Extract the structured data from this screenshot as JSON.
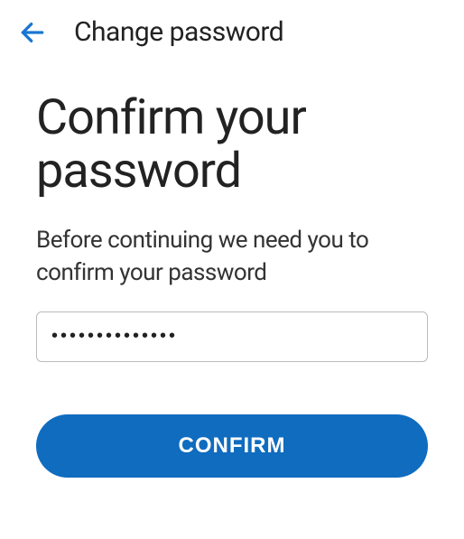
{
  "header": {
    "title": "Change password"
  },
  "main": {
    "heading": "Confirm your password",
    "description": "Before continuing we need you to confirm your password",
    "password_value": "••••••••••••••",
    "confirm_label": "CONFIRM"
  }
}
